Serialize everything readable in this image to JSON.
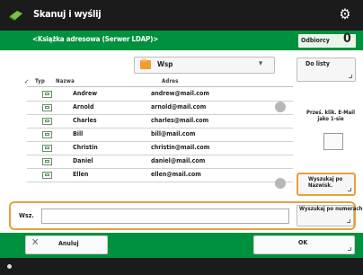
{
  "header": {
    "title": "Skanuj i wyślij"
  },
  "server": {
    "label": "<Książka adresowa (Serwer LDAP)>",
    "counter_label": "Odbiorcy",
    "counter_value": "0"
  },
  "dropdown": {
    "selected": "Wsp"
  },
  "buttons": {
    "add_to_list": "Do listy",
    "forward_email": "Prześ. klik. E-Mail jako 1-sie",
    "search_by_name": "Wyszukaj po Nazwisk.",
    "search_by_number": "Wyszukaj po numerach",
    "cancel": "Anuluj",
    "ok": "OK"
  },
  "columns": {
    "check": "✓",
    "type": "Typ",
    "name": "Nazwa",
    "address": "Adres"
  },
  "rows": [
    {
      "name": "Andrew",
      "address": "andrew@mail.com"
    },
    {
      "name": "Arnold",
      "address": "arnold@mail.com"
    },
    {
      "name": "Charles",
      "address": "charles@mail.com"
    },
    {
      "name": "Bill",
      "address": "bill@mail.com"
    },
    {
      "name": "Christin",
      "address": "christin@mail.com"
    },
    {
      "name": "Daniel",
      "address": "daniel@mail.com"
    },
    {
      "name": "Ellen",
      "address": "ellen@mail.com"
    }
  ],
  "filter": {
    "label": "Wsz.",
    "value": ""
  },
  "colors": {
    "accent_green": "#00913f",
    "highlight_orange": "#e6a13c",
    "header_black": "#1b1b1b"
  },
  "icons": {
    "logo": "scan-send-logo-icon",
    "settings": "gear-icon",
    "folder": "address-book-icon",
    "entry": "email-entry-icon"
  }
}
